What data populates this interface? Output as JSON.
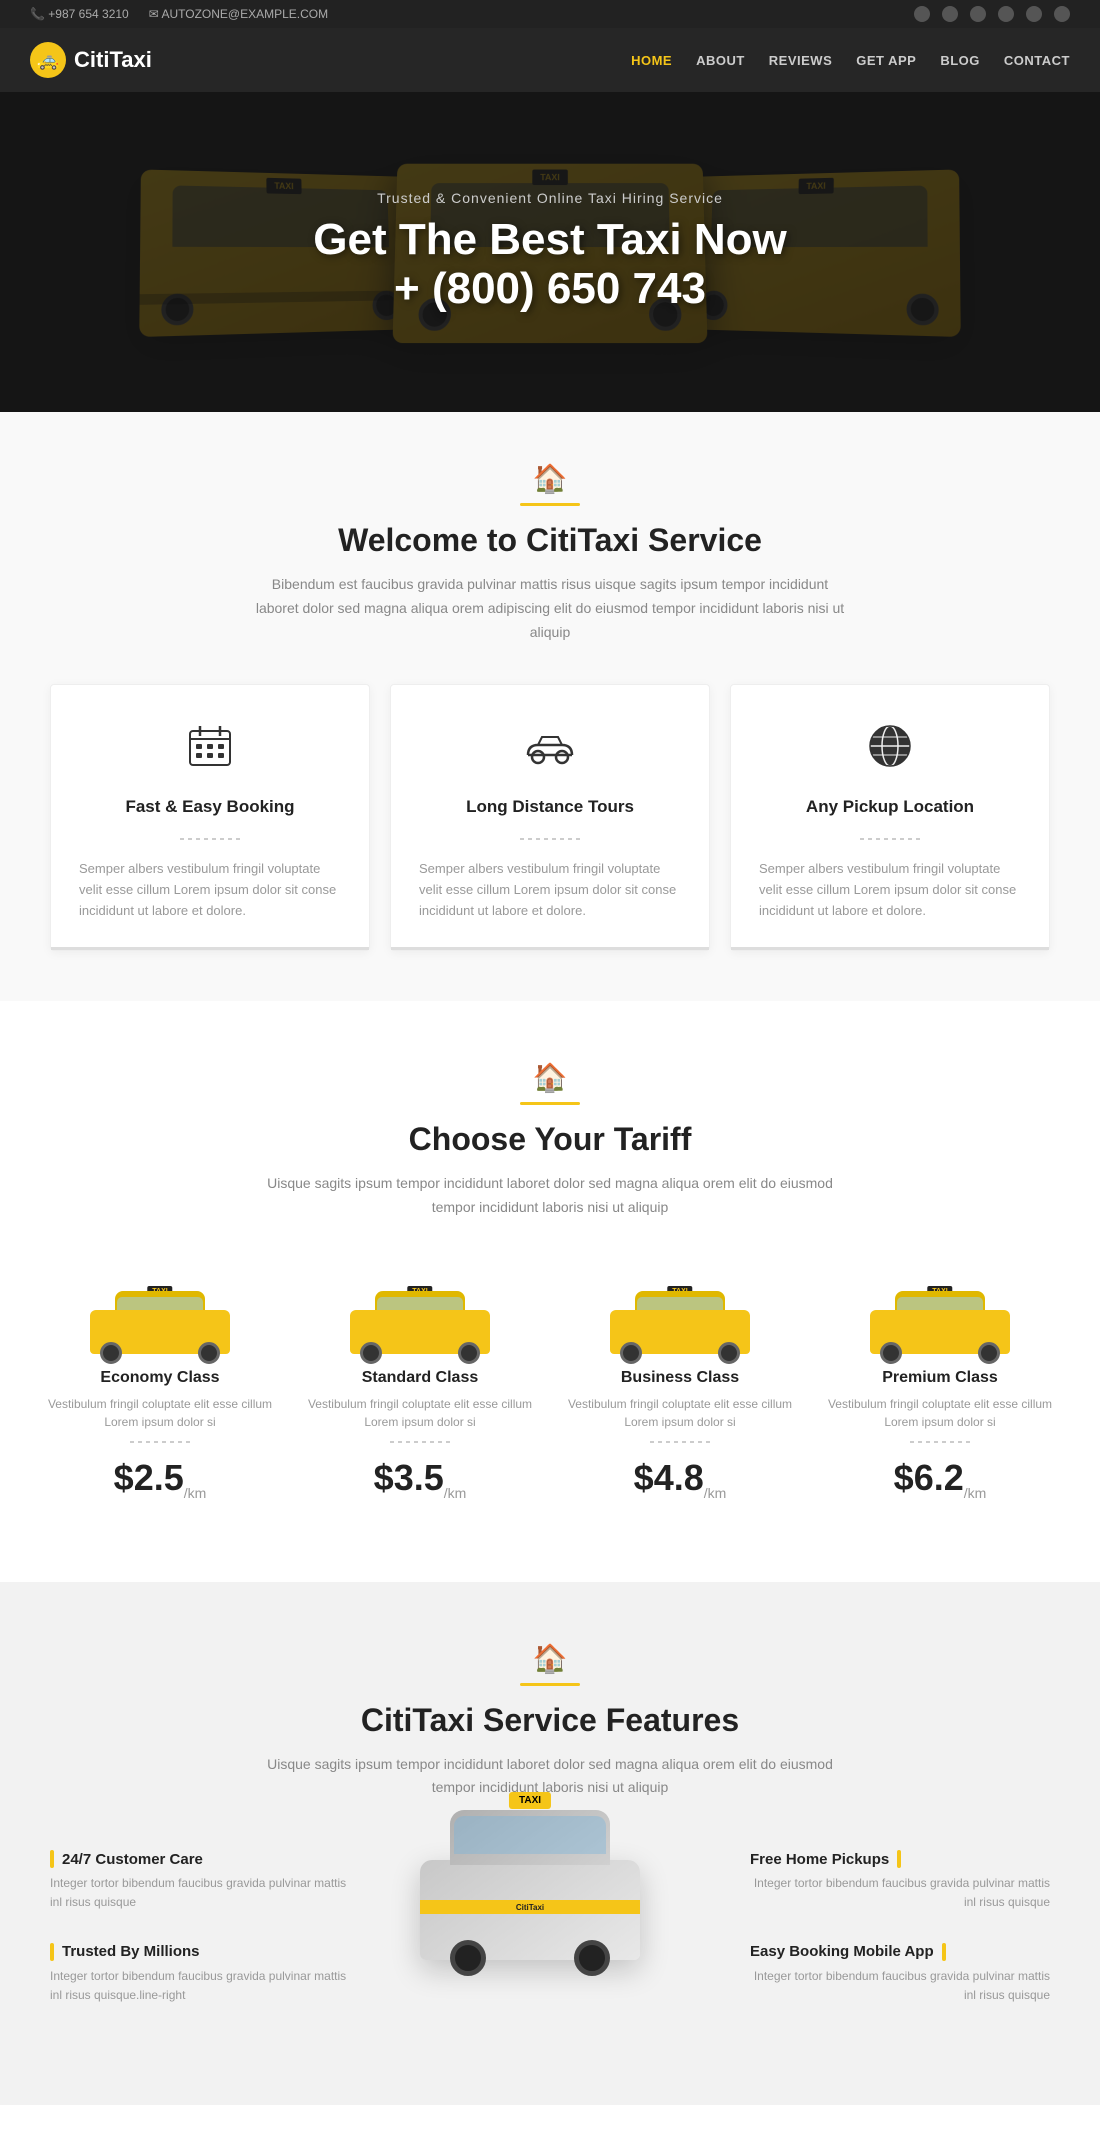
{
  "topbar": {
    "phone": "+987 654 3210",
    "email": "AUTOZONE@EXAMPLE.COM",
    "phone_icon": "📞",
    "email_icon": "✉"
  },
  "header": {
    "logo_text_1": "Citi",
    "logo_text_2": "Taxi",
    "logo_taxi": "🚕",
    "nav": [
      {
        "label": "HOME",
        "href": "#",
        "active": true
      },
      {
        "label": "ABOUT",
        "href": "#",
        "active": false
      },
      {
        "label": "REVIEWS",
        "href": "#",
        "active": false
      },
      {
        "label": "GET APP",
        "href": "#",
        "active": false
      },
      {
        "label": "BLOG",
        "href": "#",
        "active": false
      },
      {
        "label": "CONTACT",
        "href": "#",
        "active": false
      }
    ]
  },
  "hero": {
    "subtitle": "Trusted & Convenient Online Taxi Hiring Service",
    "title": "Get The Best Taxi Now",
    "phone": "+ (800) 650 743"
  },
  "welcome": {
    "section_icon": "🏠",
    "title": "Welcome to CitiTaxi Service",
    "description": "Bibendum est faucibus gravida pulvinar mattis risus uisque sagits ipsum tempor incididunt laboret dolor sed magna aliqua orem adipiscing elit do eiusmod tempor incididunt laboris nisi ut aliquip",
    "cards": [
      {
        "icon": "📅",
        "title": "Fast & Easy Booking",
        "desc": "Semper albers vestibulum fringil voluptate velit esse cillum Lorem ipsum dolor sit conse incididunt ut labore et dolore."
      },
      {
        "icon": "🚗",
        "title": "Long Distance Tours",
        "desc": "Semper albers vestibulum fringil voluptate velit esse cillum Lorem ipsum dolor sit conse incididunt ut labore et dolore."
      },
      {
        "icon": "🌍",
        "title": "Any Pickup Location",
        "desc": "Semper albers vestibulum fringil voluptate velit esse cillum Lorem ipsum dolor sit conse incididunt ut labore et dolore."
      }
    ]
  },
  "tariff": {
    "section_icon": "🏠",
    "title": "Choose Your Tariff",
    "description": "Uisque sagits ipsum tempor incididunt laboret dolor sed magna aliqua orem elit do eiusmod tempor incididunt laboris nisi ut aliquip",
    "classes": [
      {
        "name": "Economy Class",
        "desc": "Vestibulum fringil coluptate elit esse cillum Lorem ipsum dolor si",
        "price": "$2.5",
        "unit": "/km"
      },
      {
        "name": "Standard Class",
        "desc": "Vestibulum fringil coluptate elit esse cillum Lorem ipsum dolor si",
        "price": "$3.5",
        "unit": "/km"
      },
      {
        "name": "Business Class",
        "desc": "Vestibulum fringil coluptate elit esse cillum Lorem ipsum dolor si",
        "price": "$4.8",
        "unit": "/km"
      },
      {
        "name": "Premium Class",
        "desc": "Vestibulum fringil coluptate elit esse cillum Lorem ipsum dolor si",
        "price": "$6.2",
        "unit": "/km"
      }
    ]
  },
  "features": {
    "section_icon": "🏠",
    "title": "CitiTaxi Service Features",
    "description": "Uisque sagits ipsum tempor incididunt laboret dolor sed magna aliqua orem elit do eiusmod tempor incididunt laboris nisi ut aliquip",
    "left_features": [
      {
        "title": "24/7 Customer Care",
        "desc": "Integer tortor bibendum faucibus gravida pulvinar mattis inl risus quisque"
      },
      {
        "title": "Trusted By Millions",
        "desc": "Integer tortor bibendum faucibus gravida pulvinar mattis inl risus quisque.line-right"
      }
    ],
    "right_features": [
      {
        "title": "Free Home Pickups",
        "desc": "Integer tortor bibendum faucibus gravida pulvinar mattis inl risus quisque"
      },
      {
        "title": "Easy Booking Mobile App",
        "desc": "Integer tortor bibendum faucibus gravida pulvinar mattis inl risus quisque"
      }
    ]
  }
}
